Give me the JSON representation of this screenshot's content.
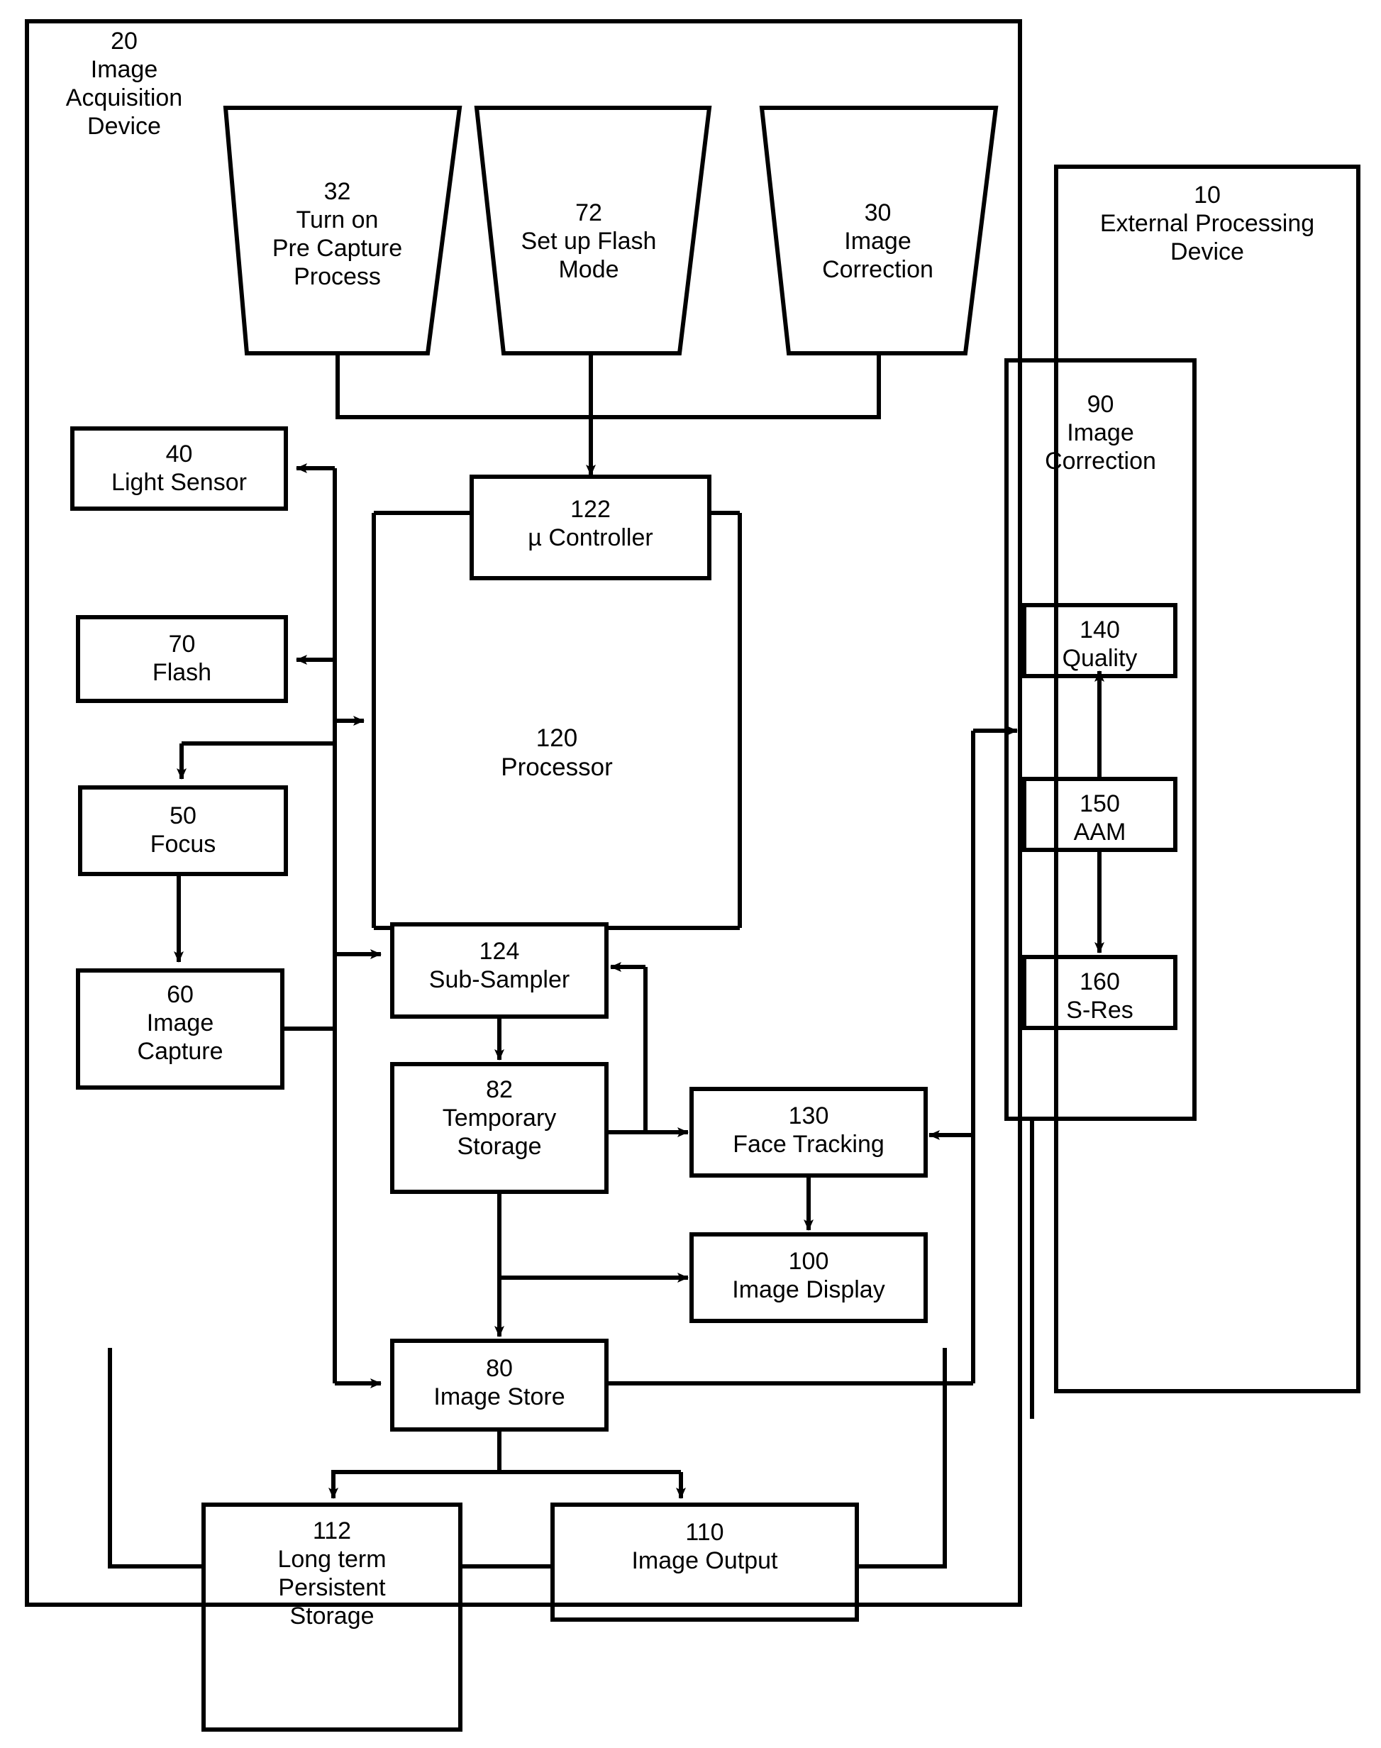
{
  "figure": {
    "type": "patent-block-diagram",
    "background": "#ffffff",
    "stroke": "#000000"
  },
  "containers": {
    "acquisition_device": {
      "ref": "20",
      "name": "Image\nAcquisition\nDevice",
      "full_label": "20\nImage\nAcquisition\nDevice"
    },
    "external_device": {
      "ref": "10",
      "name": "External Processing\nDevice",
      "full_label": "10\nExternal Processing\nDevice"
    },
    "processor": {
      "ref": "120",
      "name": "Processor",
      "full_label": "120\nProcessor"
    },
    "image_correction_module": {
      "ref": "90",
      "name": "Image\nCorrection",
      "full_label": "90\nImage\nCorrection"
    }
  },
  "trapezoids": [
    {
      "ref": "32",
      "name": "Turn on\nPre Capture\nProcess",
      "full_label": "32\nTurn on\nPre Capture\nProcess"
    },
    {
      "ref": "72",
      "name": "Set up Flash\nMode",
      "full_label": "72\nSet up Flash\nMode"
    },
    {
      "ref": "30",
      "name": "Image\nCorrection",
      "full_label": "30\nImage\nCorrection"
    }
  ],
  "blocks": [
    {
      "ref": "122",
      "name": "µ Controller",
      "full_label": "122\nµ Controller"
    },
    {
      "ref": "40",
      "name": "Light Sensor",
      "full_label": "40\nLight Sensor"
    },
    {
      "ref": "70",
      "name": "Flash",
      "full_label": "70\nFlash"
    },
    {
      "ref": "50",
      "name": "Focus",
      "full_label": "50\nFocus"
    },
    {
      "ref": "60",
      "name": "Image\nCapture",
      "full_label": "60\nImage\nCapture"
    },
    {
      "ref": "124",
      "name": "Sub-Sampler",
      "full_label": "124\nSub-Sampler"
    },
    {
      "ref": "82",
      "name": "Temporary\nStorage",
      "full_label": "82\nTemporary\nStorage"
    },
    {
      "ref": "130",
      "name": "Face Tracking",
      "full_label": "130\nFace Tracking"
    },
    {
      "ref": "100",
      "name": "Image Display",
      "full_label": "100\nImage Display"
    },
    {
      "ref": "80",
      "name": "Image Store",
      "full_label": "80\nImage Store"
    },
    {
      "ref": "112",
      "name": "Long term\nPersistent\nStorage",
      "full_label": "112\nLong term\nPersistent\nStorage"
    },
    {
      "ref": "110",
      "name": "Image Output",
      "full_label": "110\nImage Output"
    },
    {
      "ref": "140",
      "name": "Quality",
      "full_label": "140\nQuality"
    },
    {
      "ref": "150",
      "name": "AAM",
      "full_label": "150\nAAM"
    },
    {
      "ref": "160",
      "name": "S-Res",
      "full_label": "160\nS-Res"
    }
  ],
  "connections": [
    {
      "from": "32",
      "to": "122",
      "style": "bus-arrow"
    },
    {
      "from": "72",
      "to": "122",
      "style": "bus-arrow"
    },
    {
      "from": "30",
      "to": "122",
      "style": "bus-arrow"
    },
    {
      "from": "120",
      "to": "40",
      "style": "arrow"
    },
    {
      "from": "120",
      "to": "70",
      "style": "arrow"
    },
    {
      "from": "120",
      "to": "120",
      "style": "arrow"
    },
    {
      "from": "70",
      "to": "50",
      "style": "arrow"
    },
    {
      "from": "50",
      "to": "60",
      "style": "arrow"
    },
    {
      "from": "60",
      "to": "124",
      "style": "arrow"
    },
    {
      "from": "60",
      "to": "80",
      "style": "arrow"
    },
    {
      "from": "124",
      "to": "82",
      "style": "arrow"
    },
    {
      "from": "82",
      "to": "130",
      "style": "arrow"
    },
    {
      "from": "82",
      "to": "100",
      "style": "arrow"
    },
    {
      "from": "82",
      "to": "80",
      "style": "arrow"
    },
    {
      "from": "130",
      "to": "124",
      "style": "arrow"
    },
    {
      "from": "130",
      "to": "100",
      "style": "arrow"
    },
    {
      "from": "80",
      "to": "112",
      "style": "arrow"
    },
    {
      "from": "80",
      "to": "110",
      "style": "arrow"
    },
    {
      "from": "80",
      "to": "90",
      "style": "arrow"
    },
    {
      "from": "90",
      "to": "130",
      "style": "arrow"
    },
    {
      "from": "150",
      "to": "140",
      "style": "arrow"
    },
    {
      "from": "150",
      "to": "160",
      "style": "arrow"
    }
  ]
}
